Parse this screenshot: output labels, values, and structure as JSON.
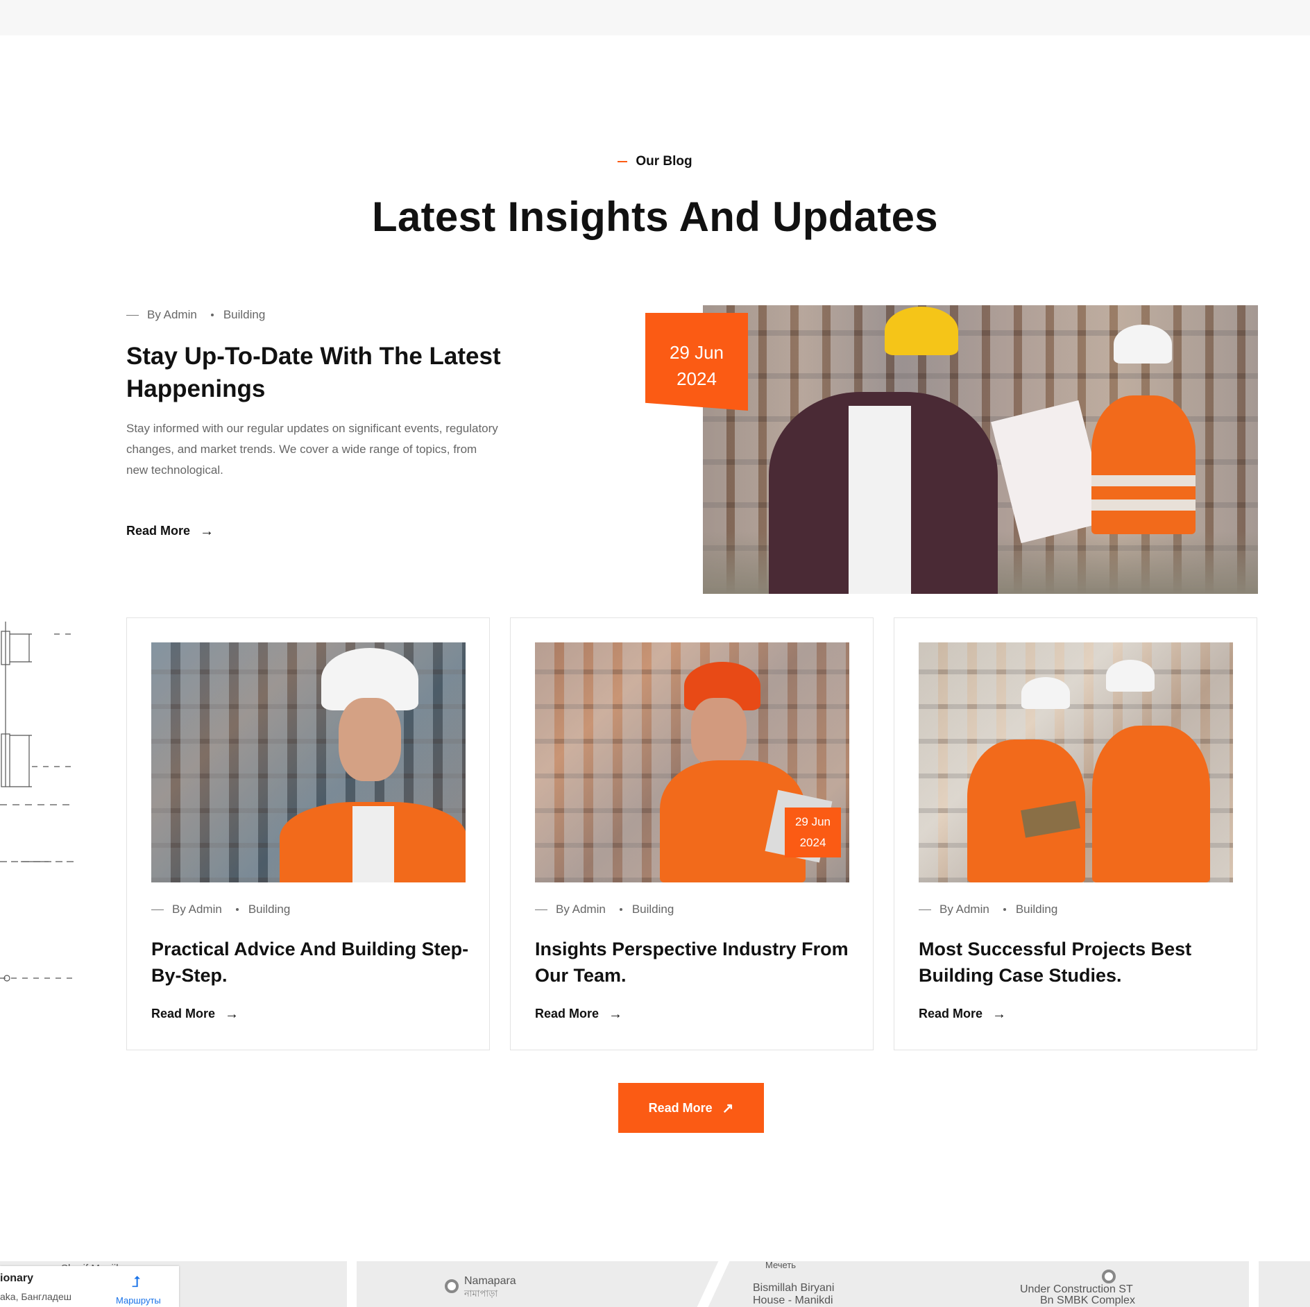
{
  "section": {
    "eyebrow": "Our Blog",
    "title": "Latest Insights And Updates"
  },
  "featured": {
    "author": "By Admin",
    "category": "Building",
    "title": "Stay Up-To-Date With The Latest Happenings",
    "excerpt": "Stay informed with our regular updates on significant events, regulatory changes, and market trends. We cover a wide range of topics, from new technological.",
    "read_more": "Read More",
    "date_day": "29 Jun",
    "date_year": "2024"
  },
  "posts": [
    {
      "author": "By Admin",
      "category": "Building",
      "title": "Practical Advice And Building Step-By-Step.",
      "read_more": "Read More"
    },
    {
      "author": "By Admin",
      "category": "Building",
      "title": "Insights Perspective Industry From Our Team.",
      "read_more": "Read More",
      "date_day": "29 Jun",
      "date_year": "2024"
    },
    {
      "author": "By Admin",
      "category": "Building",
      "title": "Most Successful Projects Best Building Case Studies.",
      "read_more": "Read More"
    }
  ],
  "cta": {
    "label": "Read More"
  },
  "map": {
    "panel_title": "ionary",
    "panel_subtitle": "aka, Бангладеш",
    "directions_label": "Маршруты",
    "labels": [
      "Sharif Monjil",
      "Namapara",
      "নামাপাড়া",
      "Мечеть",
      "Bismillah Biryani",
      "House - Manikdi",
      "Under Construction ST",
      "Bn SMBK Complex"
    ]
  },
  "colors": {
    "accent": "#fb5b14",
    "text": "#111111",
    "muted": "#666666"
  },
  "icons": {
    "arrow": "→",
    "cta_arrow": "↗",
    "directions": "directions-icon"
  }
}
